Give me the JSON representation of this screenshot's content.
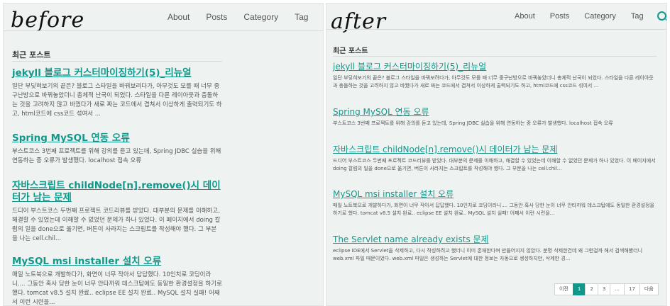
{
  "before": {
    "label": "before",
    "nav": [
      "About",
      "Posts",
      "Category",
      "Tag"
    ],
    "section_title": "최근 포스트",
    "posts": [
      {
        "title": "jekyll 블로그 커스터마이징하기(5)_리뉴얼",
        "excerpt": "일단 부딪혀보기의 끝은? 블로그 스타일을 바꿔보려다가, 아무것도 모를 때 너무 중구난방으로 바꿔놓았더니 총체적 난국이 되었다. 스타일을 다른 레이아웃과 충돌하는 것을 고려하지 않고 바꿨다가 새로 짜는 코드에서 겹쳐서 이상하게 출력되기도 하고, html코드에 css코드 섞여서 ..."
      },
      {
        "title": "Spring MySQL 연동 오류",
        "excerpt": "부스트코스 3번째 프로젝트를 위해 강의를 듣고 있는데, Spring JDBC 실습을 위해 연동하는 중 오류가 발생했다. localhost 접속 오류"
      },
      {
        "title": "자바스크립트 childNode[n].remove()시 데이터가 남는 문제",
        "excerpt": "드디어 부스트코스 두번째 프로젝트 코드리뷰를 받았다. 대부분의 문제를 이해하고, 해결할 수 있었는데 이해할 수 없었던 문제가 하나 있었다. 이 페이지에서 doing 칼럼의 일을 done으로 옮기면, 버튼이 사라지는 스크립트를 작성해야 했다. 그 부분을 나는 cell.chil..."
      },
      {
        "title": "MySQL msi installer 설치 오류",
        "excerpt": "매일 노트북으로 개발하다가, 화면이 너무 작아서 답답했다. 10인치로 코딩이라니.... 그동안 혹사 당한 눈이 너무 안타까워 데스크탑에도 동일한 환경설정을 하기로 했다. tomcat v8.5 설치 완료.. eclipse EE 설치 완료.. MySQL 설치 실패! 어째서 이런 시련을..."
      }
    ]
  },
  "after": {
    "label": "after",
    "nav": [
      "About",
      "Posts",
      "Category",
      "Tag"
    ],
    "section_title": "최근 포스트",
    "posts": [
      {
        "title": "jekyll 블로그 커스터마이징하기(5)_리뉴얼",
        "excerpt": "일단 부딪혀보기의 끝은? 블로그 스타일을 바꿔보려다가, 아무것도 모를 때 너무 중구난방으로 바꿔놓았더니 총체적 난국이 되었다. 스타일을 다른 레이아웃과 충돌하는 것을 고려하지 않고 바꿨다가 새로 짜는 코드에서 겹쳐서 이상하게 출력되기도 하고, html코드에 css코드 섞여서 ..."
      },
      {
        "title": "Spring MySQL 연동 오류",
        "excerpt": "부스트코스 3번째 프로젝트를 위해 강의를 듣고 있는데, Spring JDBC 실습을 위해 연동하는 중 오류가 발생했다. localhost 접속 오류"
      },
      {
        "title": "자바스크립트 childNode[n].remove()시 데이터가 남는 문제",
        "excerpt": "드디어 부스트코스 두번째 프로젝트 코드리뷰를 받았다. 대부분의 문제를 이해하고, 해결할 수 있었는데 이해할 수 없었던 문제가 하나 있었다. 이 페이지에서 doing 칼럼의 일을 done으로 옮기면, 버튼이 사라지는 스크립트를 작성해야 했다. 그 부분을 나는 cell.chil..."
      },
      {
        "title": "MySQL msi installer 설치 오류",
        "excerpt": "매일 노트북으로 개발하다가, 화면이 너무 작아서 답답했다. 10인치로 코딩이라니.... 그동안 혹사 당한 눈이 너무 안타까워 데스크탑에도 동일한 환경설정을 하기로 했다. tomcat v8.5 설치 완료.. eclipse EE 설치 완료.. MySQL 설치 실패! 어째서 이런 시련을..."
      },
      {
        "title": "The Servlet name already exists 문제",
        "excerpt": "eclipse IDE에서 Servlet을 삭제하고, 다시 작성하려고 했더니 이미 존재한다며 만들어지지 않았다. 분명 삭제한건데 왜 그런걸까 해서 검색해봤더니 web.xml 파일 때문이었다. web.xml 파일은 생성하는 Servlet에 대한 정보는 자동으로 생성하지만, 삭제한 경..."
      }
    ],
    "pagination": [
      "이전",
      "1",
      "2",
      "3",
      "...",
      "17",
      "다음"
    ],
    "active_page": "1"
  },
  "colors": {
    "accent": "#12988b",
    "panel_bg": "#eef2f1"
  }
}
